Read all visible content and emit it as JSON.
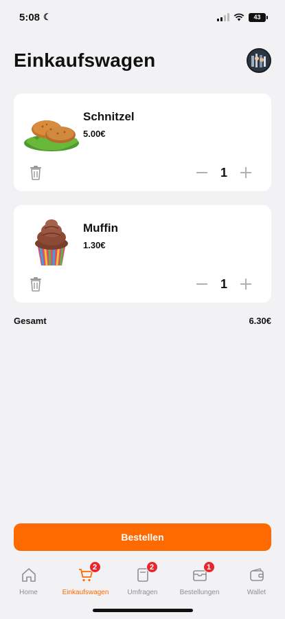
{
  "status_bar": {
    "time": "5:08",
    "battery": "43"
  },
  "header": {
    "title": "Einkaufswagen"
  },
  "cart": {
    "items": [
      {
        "name": "Schnitzel",
        "price": "5.00€",
        "quantity": "1"
      },
      {
        "name": "Muffin",
        "price": "1.30€",
        "quantity": "1"
      }
    ],
    "total_label": "Gesamt",
    "total_value": "6.30€"
  },
  "order_button": {
    "label": "Bestellen"
  },
  "tab_bar": {
    "tabs": [
      {
        "label": "Home",
        "icon": "home-icon",
        "badge": ""
      },
      {
        "label": "Einkaufswagen",
        "icon": "cart-icon",
        "badge": "2",
        "active": true
      },
      {
        "label": "Umfragen",
        "icon": "survey-icon",
        "badge": "2"
      },
      {
        "label": "Bestellungen",
        "icon": "orders-icon",
        "badge": "1"
      },
      {
        "label": "Wallet",
        "icon": "wallet-icon",
        "badge": ""
      }
    ]
  },
  "colors": {
    "accent": "#ff6a00",
    "badge": "#e8262d",
    "background": "#f2f2f4",
    "inactive": "#8e8e93"
  }
}
